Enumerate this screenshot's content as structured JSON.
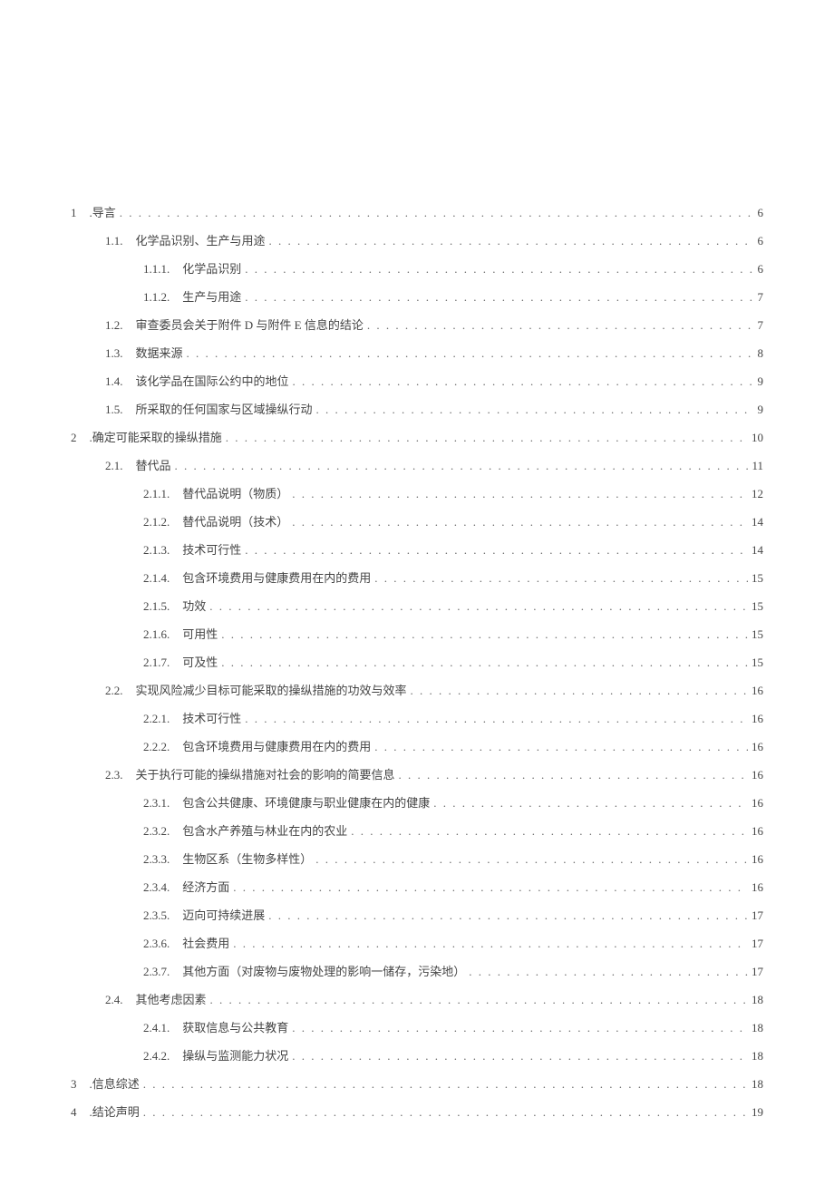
{
  "toc": [
    {
      "level": 0,
      "num": "1",
      "label": ".导言",
      "page": "6"
    },
    {
      "level": 1,
      "num": "1.1.",
      "label": "化学品识别、生产与用途",
      "page": "6"
    },
    {
      "level": 2,
      "num": "1.1.1.",
      "label": "化学品识别",
      "page": "6"
    },
    {
      "level": 2,
      "num": "1.1.2.",
      "label": "生产与用途",
      "page": "7"
    },
    {
      "level": 1,
      "num": "1.2.",
      "label": "审查委员会关于附件 D 与附件 E 信息的结论",
      "page": "7"
    },
    {
      "level": 1,
      "num": "1.3.",
      "label": "数据来源",
      "page": "8"
    },
    {
      "level": 1,
      "num": "1.4.",
      "label": "该化学品在国际公约中的地位",
      "page": "9"
    },
    {
      "level": 1,
      "num": "1.5.",
      "label": "所采取的任何国家与区域操纵行动",
      "page": "9"
    },
    {
      "level": 0,
      "num": "2",
      "label": ".确定可能采取的操纵措施",
      "page": "10"
    },
    {
      "level": 1,
      "num": "2.1.",
      "label": "替代品",
      "page": "11"
    },
    {
      "level": 2,
      "num": "2.1.1.",
      "label": "替代品说明（物质）",
      "page": "12"
    },
    {
      "level": 2,
      "num": "2.1.2.",
      "label": "替代品说明（技术）",
      "page": "14"
    },
    {
      "level": 2,
      "num": "2.1.3.",
      "label": "技术可行性",
      "page": "14"
    },
    {
      "level": 2,
      "num": "2.1.4.",
      "label": "包含环境费用与健康费用在内的费用",
      "page": "15"
    },
    {
      "level": 2,
      "num": "2.1.5.",
      "label": "功效",
      "page": "15"
    },
    {
      "level": 2,
      "num": "2.1.6.",
      "label": "可用性",
      "page": "15"
    },
    {
      "level": 2,
      "num": "2.1.7.",
      "label": "可及性",
      "page": "15"
    },
    {
      "level": 1,
      "num": "2.2.",
      "label": "实现风险减少目标可能采取的操纵措施的功效与效率",
      "page": "16"
    },
    {
      "level": 2,
      "num": "2.2.1.",
      "label": "技术可行性",
      "page": "16"
    },
    {
      "level": 2,
      "num": "2.2.2.",
      "label": "包含环境费用与健康费用在内的费用",
      "page": "16"
    },
    {
      "level": 1,
      "num": "2.3.",
      "label": "关于执行可能的操纵措施对社会的影响的简要信息",
      "page": "16"
    },
    {
      "level": 2,
      "num": "2.3.1.",
      "label": "包含公共健康、环境健康与职业健康在内的健康",
      "page": "16"
    },
    {
      "level": 2,
      "num": "2.3.2.",
      "label": "包含水产养殖与林业在内的农业",
      "page": "16"
    },
    {
      "level": 2,
      "num": "2.3.3.",
      "label": "生物区系（生物多样性）",
      "page": "16"
    },
    {
      "level": 2,
      "num": "2.3.4.",
      "label": "经济方面",
      "page": "16"
    },
    {
      "level": 2,
      "num": "2.3.5.",
      "label": "迈向可持续进展",
      "page": "17"
    },
    {
      "level": 2,
      "num": "2.3.6.",
      "label": "社会费用",
      "page": "17"
    },
    {
      "level": 2,
      "num": "2.3.7.",
      "label": "其他方面（对废物与废物处理的影响一储存，污染地）",
      "page": "17"
    },
    {
      "level": 1,
      "num": "2.4.",
      "label": "其他考虑因素",
      "page": "18"
    },
    {
      "level": 2,
      "num": "2.4.1.",
      "label": "获取信息与公共教育",
      "page": "18"
    },
    {
      "level": 2,
      "num": "2.4.2.",
      "label": "操纵与监测能力状况",
      "page": "18"
    },
    {
      "level": 0,
      "num": "3",
      "label": ".信息综述",
      "page": "18"
    },
    {
      "level": 0,
      "num": "4",
      "label": ".结论声明",
      "page": "19"
    }
  ]
}
